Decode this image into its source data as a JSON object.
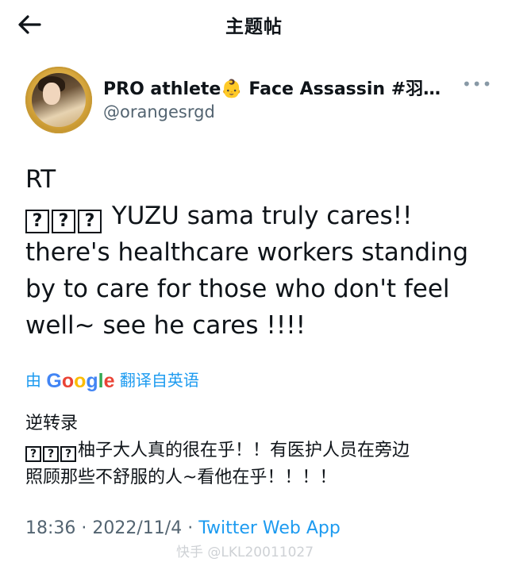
{
  "header": {
    "title": "主题帖",
    "back_icon": "arrow-left-icon"
  },
  "author": {
    "display_name": "PRO athlete👶 Face Assassin #羽生...",
    "handle": "@orangesrgd",
    "more_icon": "more-horizontal-icon"
  },
  "tweet": {
    "lines": [
      "RT",
      "YUZU sama truly cares!!",
      "there's healthcare workers standing",
      "by to care for those who don't feel",
      "well~ see he cares !!!!"
    ],
    "unrendered_glyph": "?"
  },
  "translation": {
    "prefix": "由",
    "google_word": "Google",
    "suffix": "翻译自英语"
  },
  "translated_text": {
    "lines": [
      "逆转录",
      "柚子大人真的很在乎！！有医护人员在旁边",
      "照顾那些不舒服的人~看他在乎！！！！"
    ]
  },
  "meta": {
    "time": "18:36",
    "sep": " · ",
    "date": "2022/11/4",
    "source": "Twitter Web App"
  },
  "watermark": "快手 @LKL20011027",
  "colors": {
    "link": "#1d9bf0",
    "secondary_text": "#536471"
  }
}
